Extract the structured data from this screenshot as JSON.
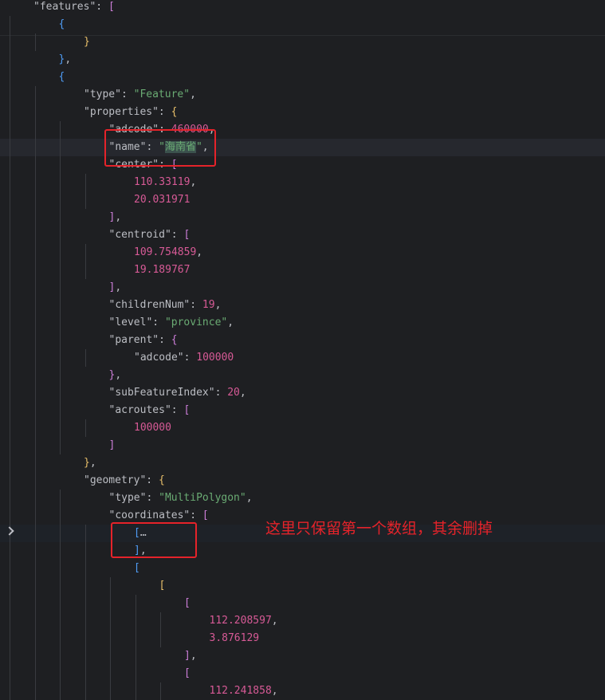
{
  "editor": {
    "lines": [
      {
        "i": 0,
        "t": [
          [
            "k",
            "\"features\""
          ],
          [
            "p",
            ": "
          ],
          [
            "b2",
            "["
          ]
        ]
      },
      {
        "i": 1,
        "t": [
          [
            "b3",
            "{"
          ]
        ]
      },
      {
        "i": 2,
        "t": [
          [
            "b1",
            "}"
          ]
        ]
      },
      {
        "i": 1,
        "t": [
          [
            "b3",
            "}"
          ],
          [
            "p",
            ","
          ]
        ]
      },
      {
        "i": 1,
        "t": [
          [
            "b3",
            "{"
          ]
        ]
      },
      {
        "i": 2,
        "t": [
          [
            "k",
            "\"type\""
          ],
          [
            "p",
            ": "
          ],
          [
            "s",
            "\"Feature\""
          ],
          [
            "p",
            ","
          ]
        ]
      },
      {
        "i": 2,
        "t": [
          [
            "k",
            "\"properties\""
          ],
          [
            "p",
            ": "
          ],
          [
            "b1",
            "{"
          ]
        ]
      },
      {
        "i": 3,
        "t": [
          [
            "k",
            "\"adcode\""
          ],
          [
            "p",
            ": "
          ],
          [
            "n",
            "460000"
          ],
          [
            "p",
            ","
          ]
        ]
      },
      {
        "i": 3,
        "t": [
          [
            "k",
            "\"name\""
          ],
          [
            "p",
            ": "
          ],
          [
            "s",
            "\""
          ],
          [
            "sel",
            "海南省"
          ],
          [
            "s",
            "\""
          ],
          [
            "p",
            ","
          ]
        ],
        "hl": true
      },
      {
        "i": 3,
        "t": [
          [
            "k",
            "\"center\""
          ],
          [
            "p",
            ": "
          ],
          [
            "b2",
            "["
          ]
        ]
      },
      {
        "i": 4,
        "t": [
          [
            "n",
            "110.33119"
          ],
          [
            "p",
            ","
          ]
        ]
      },
      {
        "i": 4,
        "t": [
          [
            "n",
            "20.031971"
          ]
        ]
      },
      {
        "i": 3,
        "t": [
          [
            "b2",
            "]"
          ],
          [
            "p",
            ","
          ]
        ]
      },
      {
        "i": 3,
        "t": [
          [
            "k",
            "\"centroid\""
          ],
          [
            "p",
            ": "
          ],
          [
            "b2",
            "["
          ]
        ]
      },
      {
        "i": 4,
        "t": [
          [
            "n",
            "109.754859"
          ],
          [
            "p",
            ","
          ]
        ]
      },
      {
        "i": 4,
        "t": [
          [
            "n",
            "19.189767"
          ]
        ]
      },
      {
        "i": 3,
        "t": [
          [
            "b2",
            "]"
          ],
          [
            "p",
            ","
          ]
        ]
      },
      {
        "i": 3,
        "t": [
          [
            "k",
            "\"childrenNum\""
          ],
          [
            "p",
            ": "
          ],
          [
            "n",
            "19"
          ],
          [
            "p",
            ","
          ]
        ]
      },
      {
        "i": 3,
        "t": [
          [
            "k",
            "\"level\""
          ],
          [
            "p",
            ": "
          ],
          [
            "s",
            "\"province\""
          ],
          [
            "p",
            ","
          ]
        ]
      },
      {
        "i": 3,
        "t": [
          [
            "k",
            "\"parent\""
          ],
          [
            "p",
            ": "
          ],
          [
            "b2",
            "{"
          ]
        ]
      },
      {
        "i": 4,
        "t": [
          [
            "k",
            "\"adcode\""
          ],
          [
            "p",
            ": "
          ],
          [
            "n",
            "100000"
          ]
        ]
      },
      {
        "i": 3,
        "t": [
          [
            "b2",
            "}"
          ],
          [
            "p",
            ","
          ]
        ]
      },
      {
        "i": 3,
        "t": [
          [
            "k",
            "\"subFeatureIndex\""
          ],
          [
            "p",
            ": "
          ],
          [
            "n",
            "20"
          ],
          [
            "p",
            ","
          ]
        ]
      },
      {
        "i": 3,
        "t": [
          [
            "k",
            "\"acroutes\""
          ],
          [
            "p",
            ": "
          ],
          [
            "b2",
            "["
          ]
        ]
      },
      {
        "i": 4,
        "t": [
          [
            "n",
            "100000"
          ]
        ]
      },
      {
        "i": 3,
        "t": [
          [
            "b2",
            "]"
          ]
        ]
      },
      {
        "i": 2,
        "t": [
          [
            "b1",
            "}"
          ],
          [
            "p",
            ","
          ]
        ]
      },
      {
        "i": 2,
        "t": [
          [
            "k",
            "\"geometry\""
          ],
          [
            "p",
            ": "
          ],
          [
            "b1",
            "{"
          ]
        ]
      },
      {
        "i": 3,
        "t": [
          [
            "k",
            "\"type\""
          ],
          [
            "p",
            ": "
          ],
          [
            "s",
            "\"MultiPolygon\""
          ],
          [
            "p",
            ","
          ]
        ]
      },
      {
        "i": 3,
        "t": [
          [
            "k",
            "\"coordinates\""
          ],
          [
            "p",
            ": "
          ],
          [
            "b2",
            "["
          ]
        ]
      },
      {
        "i": 4,
        "t": [
          [
            "b3",
            "["
          ],
          [
            "p",
            "…"
          ]
        ],
        "hl2": true
      },
      {
        "i": 4,
        "t": [
          [
            "b3",
            "]"
          ],
          [
            "p",
            ","
          ]
        ]
      },
      {
        "i": 4,
        "t": [
          [
            "b3",
            "["
          ]
        ]
      },
      {
        "i": 5,
        "t": [
          [
            "b1",
            "["
          ]
        ]
      },
      {
        "i": 6,
        "t": [
          [
            "b2",
            "["
          ]
        ]
      },
      {
        "i": 7,
        "t": [
          [
            "n",
            "112.208597"
          ],
          [
            "p",
            ","
          ]
        ]
      },
      {
        "i": 7,
        "t": [
          [
            "n",
            "3.876129"
          ]
        ]
      },
      {
        "i": 6,
        "t": [
          [
            "b2",
            "]"
          ],
          [
            "p",
            ","
          ]
        ]
      },
      {
        "i": 6,
        "t": [
          [
            "b2",
            "["
          ]
        ]
      },
      {
        "i": 7,
        "t": [
          [
            "n",
            "112.241858"
          ],
          [
            "p",
            ","
          ]
        ]
      }
    ]
  },
  "annotation": {
    "text": "这里只保留第一个数组，其余删掉",
    "color": "#e5232a"
  },
  "colors": {
    "background": "#1e1f22",
    "string": "#6aab73",
    "number": "#d75a96",
    "key": "#bcbec4"
  }
}
